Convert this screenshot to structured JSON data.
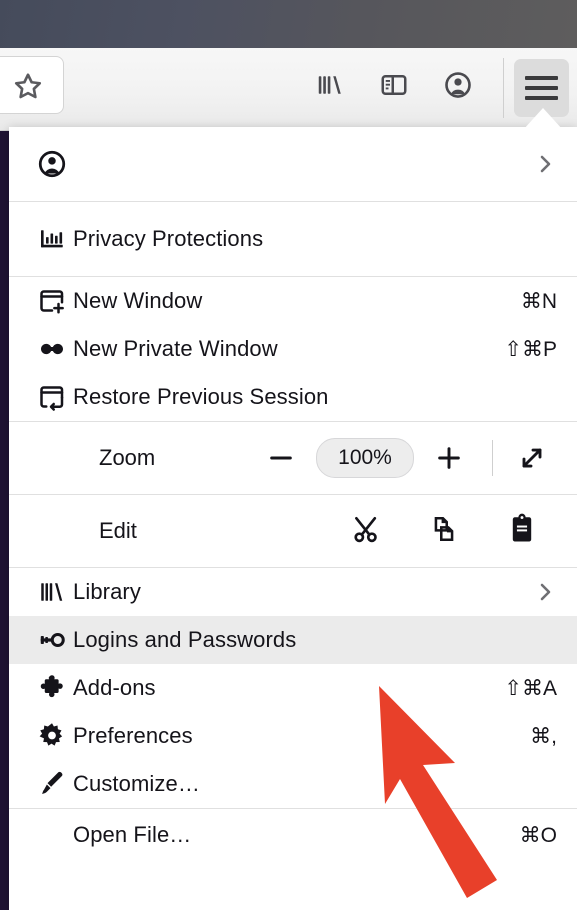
{
  "window": {
    "titlebar_gradient_from": "#454b5b",
    "titlebar_gradient_to": "#5e5d5d",
    "page_background": "#1f1333"
  },
  "toolbar": {
    "bookmark_star": "bookmark-star",
    "library_icon": "library-icon",
    "sidebar_icon": "sidebar-icon",
    "account_icon": "account-icon",
    "menu_icon": "hamburger-menu-icon"
  },
  "menu": {
    "account_row": {
      "label": "",
      "icon": "account-avatar-icon",
      "chevron": "›"
    },
    "privacy": {
      "label": "Privacy Protections",
      "icon": "privacy-chart-icon"
    },
    "windows": [
      {
        "label": "New Window",
        "shortcut": "⌘N",
        "icon": "new-window-icon"
      },
      {
        "label": "New Private Window",
        "shortcut": "⇧⌘P",
        "icon": "private-window-mask-icon"
      },
      {
        "label": "Restore Previous Session",
        "shortcut": "",
        "icon": "restore-session-icon"
      }
    ],
    "zoom": {
      "label": "Zoom",
      "minus": "−",
      "level": "100%",
      "plus": "+",
      "fullscreen_icon": "fullscreen-expand-icon"
    },
    "edit": {
      "label": "Edit",
      "cut_icon": "cut-scissors-icon",
      "copy_icon": "copy-icon",
      "paste_icon": "paste-clipboard-icon"
    },
    "items": [
      {
        "label": "Library",
        "shortcut": "",
        "icon": "library-books-icon",
        "chevron": "›",
        "highlighted": false
      },
      {
        "label": "Logins and Passwords",
        "shortcut": "",
        "icon": "key-icon",
        "chevron": "",
        "highlighted": true
      },
      {
        "label": "Add-ons",
        "shortcut": "⇧⌘A",
        "icon": "puzzle-piece-icon",
        "chevron": "",
        "highlighted": false
      },
      {
        "label": "Preferences",
        "shortcut": "⌘,",
        "icon": "gear-icon",
        "chevron": "",
        "highlighted": false
      },
      {
        "label": "Customize…",
        "shortcut": "",
        "icon": "paintbrush-icon",
        "chevron": "",
        "highlighted": false
      }
    ],
    "footer": [
      {
        "label": "Open File…",
        "shortcut": "⌘O",
        "icon": ""
      }
    ]
  },
  "annotation": {
    "arrow_color": "#E8402A",
    "points_to": "Logins and Passwords"
  }
}
